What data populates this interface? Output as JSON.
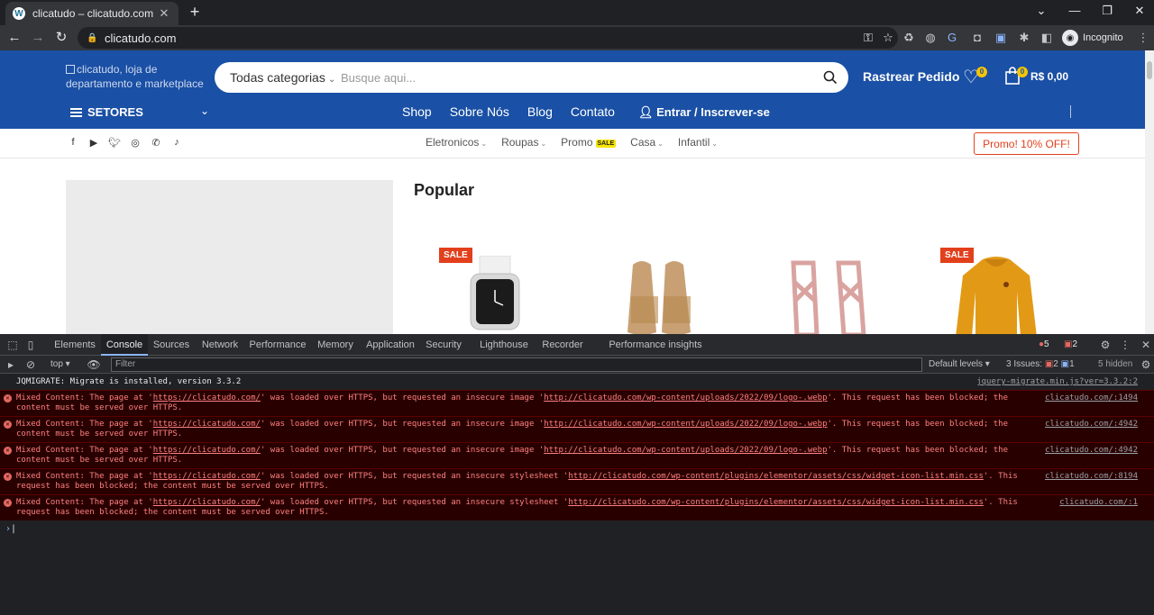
{
  "browser": {
    "tab_title": "clicatudo – clicatudo.com",
    "tab_favicon": "W",
    "url": "clicatudo.com",
    "profile_label": "Incognito"
  },
  "site": {
    "logo_alt": "clicatudo, loja de departamento e marketplace",
    "search": {
      "category_label": "Todas categorias",
      "placeholder": "Busque aqui..."
    },
    "track_order": "Rastrear Pedido",
    "wishlist_count": "0",
    "cart_count": "0",
    "cart_total": "R$ 0,00",
    "setores_label": "SETORES",
    "main_nav": [
      "Shop",
      "Sobre Nós",
      "Blog",
      "Contato"
    ],
    "login_label": "Entrar / Inscrever-se",
    "categories": [
      "Eletronicos",
      "Roupas",
      "Promo",
      "Casa",
      "Infantil"
    ],
    "promo_chip": "SALE",
    "promo_button": "Promo! 10% OFF!",
    "section_title": "Popular",
    "sale_tag": "SALE"
  },
  "devtools": {
    "tabs": [
      "Elements",
      "Console",
      "Sources",
      "Network",
      "Performance",
      "Memory",
      "Application",
      "Security",
      "Lighthouse",
      "Recorder",
      "Performance insights"
    ],
    "error_count": "5",
    "issue_count": "2",
    "context": "top",
    "filter_placeholder": "Filter",
    "levels": "Default levels",
    "issues_label": "3 Issues:",
    "issues_err": "2",
    "issues_info": "1",
    "hidden": "5 hidden",
    "messages": [
      {
        "type": "info",
        "text": "JQMIGRATE: Migrate is installed, version 3.3.2",
        "source": "jquery-migrate.min.js?ver=3.3.2:2"
      },
      {
        "type": "error",
        "pre": "Mixed Content: The page at '",
        "page": "https://clicatudo.com/",
        "mid": "' was loaded over HTTPS, but requested an insecure image '",
        "res": "http://clicatudo.com/wp-content/uploads/2022/09/logo-.webp",
        "post": "'. This request has been blocked; the content must be served over HTTPS.",
        "source": "clicatudo.com/:1494"
      },
      {
        "type": "error",
        "pre": "Mixed Content: The page at '",
        "page": "https://clicatudo.com/",
        "mid": "' was loaded over HTTPS, but requested an insecure image '",
        "res": "http://clicatudo.com/wp-content/uploads/2022/09/logo-.webp",
        "post": "'. This request has been blocked; the content must be served over HTTPS.",
        "source": "clicatudo.com/:4942"
      },
      {
        "type": "error",
        "pre": "Mixed Content: The page at '",
        "page": "https://clicatudo.com/",
        "mid": "' was loaded over HTTPS, but requested an insecure image '",
        "res": "http://clicatudo.com/wp-content/uploads/2022/09/logo-.webp",
        "post": "'. This request has been blocked; the content must be served over HTTPS.",
        "source": "clicatudo.com/:4942"
      },
      {
        "type": "error",
        "pre": "Mixed Content: The page at '",
        "page": "https://clicatudo.com/",
        "mid": "' was loaded over HTTPS, but requested an insecure stylesheet '",
        "res": "http://clicatudo.com/wp-content/plugins/elementor/assets/css/widget-icon-list.min.css",
        "post": "'. This request has been blocked; the content must be served over HTTPS.",
        "source": "clicatudo.com/:8194"
      },
      {
        "type": "error",
        "pre": "Mixed Content: The page at '",
        "page": "https://clicatudo.com/",
        "mid": "' was loaded over HTTPS, but requested an insecure stylesheet '",
        "res": "http://clicatudo.com/wp-content/plugins/elementor/assets/css/widget-icon-list.min.css",
        "post": "'. This request has been blocked; the content must be served over HTTPS.",
        "source": "clicatudo.com/:1"
      }
    ]
  },
  "colors": {
    "header_blue": "#1a50a5",
    "sale_orange": "#e2401c",
    "badge_yellow": "#f5c400"
  }
}
